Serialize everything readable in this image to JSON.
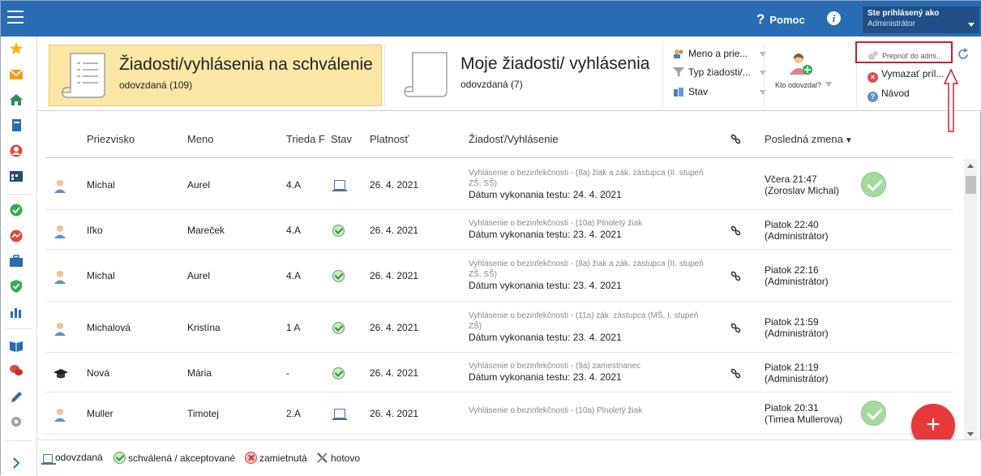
{
  "topbar": {
    "help_label": "Pomoc",
    "user_line1": "Ste prihlásený ako",
    "user_line2": "Administrátor"
  },
  "tiles": {
    "pending_title": "Žiadosti/vyhlásenia na schválenie",
    "pending_sub": "odovzdaná (109)",
    "mine_title": "Moje žiadosti/ vyhlásenia",
    "mine_sub": "odovzdaná (7)"
  },
  "filters": {
    "name": "Meno a prie...",
    "type": "Typ žiadosti/...",
    "status": "Stav",
    "who_submitted": "Kto odovzdal?"
  },
  "actions": {
    "switch_admin": "Prepnúť do admi...",
    "delete_attachments": "Vymazať príl...",
    "guide": "Návod"
  },
  "table": {
    "headers": {
      "surname": "Priezvisko",
      "name": "Meno",
      "class": "Trieda F",
      "status": "Stav",
      "validity": "Platnosť",
      "request": "Žiadosť/Vyhlásenie",
      "last_change": "Posledná zmena"
    },
    "rows": [
      {
        "surname": "Michal",
        "name": "Aurel",
        "class": "4.A",
        "status": "odovzdana",
        "validity": "26. 4. 2021",
        "req_line1": "Vyhlásenie o bezinfekčnosti - (8a) žiak a zák. zástupca (II. stupeň ZŠ, SŠ)",
        "req_line2": "Dátum vykonania testu: 24. 4. 2021",
        "link": false,
        "change_time": "Včera 21:47",
        "change_by": "(Zoroslav Michal)",
        "approved_big": true,
        "role": "person"
      },
      {
        "surname": "Iľko",
        "name": "Mareček",
        "class": "4.A",
        "status": "schvalena",
        "validity": "26. 4. 2021",
        "req_line1": "Vyhlásenie o bezinfekčnosti - (10a) Plnoletý žiak",
        "req_line2": "Dátum vykonania testu: 23. 4. 2021",
        "link": true,
        "change_time": "Piatok 22:40",
        "change_by": "(Administrátor)",
        "approved_big": false,
        "role": "person"
      },
      {
        "surname": "Michal",
        "name": "Aurel",
        "class": "4.A",
        "status": "schvalena",
        "validity": "26. 4. 2021",
        "req_line1": "Vyhlásenie o bezinfekčnosti - (8a) žiak a zák. zástupca (II. stupeň ZŠ, SŠ)",
        "req_line2": "Dátum vykonania testu: 23. 4. 2021",
        "link": true,
        "change_time": "Piatok 22:16",
        "change_by": "(Administrátor)",
        "approved_big": false,
        "role": "person"
      },
      {
        "surname": "Michalová",
        "name": "Kristína",
        "class": "1 A",
        "status": "schvalena",
        "validity": "26. 4. 2021",
        "req_line1": "Vyhlásenie o bezinfekčnosti - (11a) zák. zástupca (MŠ, I. stupeň ZŠ)",
        "req_line2": "Dátum vykonania testu: 23. 4. 2021",
        "link": true,
        "change_time": "Piatok 21:59",
        "change_by": "(Administrátor)",
        "approved_big": false,
        "role": "person"
      },
      {
        "surname": "Nová",
        "name": "Mária",
        "class": "-",
        "status": "schvalena",
        "validity": "26. 4. 2021",
        "req_line1": "Vyhlásenie o bezinfekčnosti - (9a) zamestnanec",
        "req_line2": "Dátum vykonania testu: 23. 4. 2021",
        "link": true,
        "change_time": "Piatok 21:19",
        "change_by": "(Administrátor)",
        "approved_big": false,
        "role": "teacher"
      },
      {
        "surname": "Muller",
        "name": "Timotej",
        "class": "2.A",
        "status": "odovzdana",
        "validity": "26. 4. 2021",
        "req_line1": "Vyhlásenie o bezinfekčnosti - (10a) Plnoletý žiak",
        "req_line2": "",
        "link": false,
        "change_time": "Piatok 20:31",
        "change_by": "(Timea Mullerova)",
        "approved_big": true,
        "role": "person"
      }
    ]
  },
  "legend": {
    "submitted": "odovzdaná",
    "approved": "schválená / akceptované",
    "rejected": "zamietnutá",
    "done": "hotovo"
  },
  "fab_label": "+",
  "colors": {
    "topbar": "#2a6cb3",
    "active_tile": "#fbe6a6",
    "approved": "#a6d9a0",
    "fab": "#e8383a",
    "annotation": "#d0202a"
  }
}
